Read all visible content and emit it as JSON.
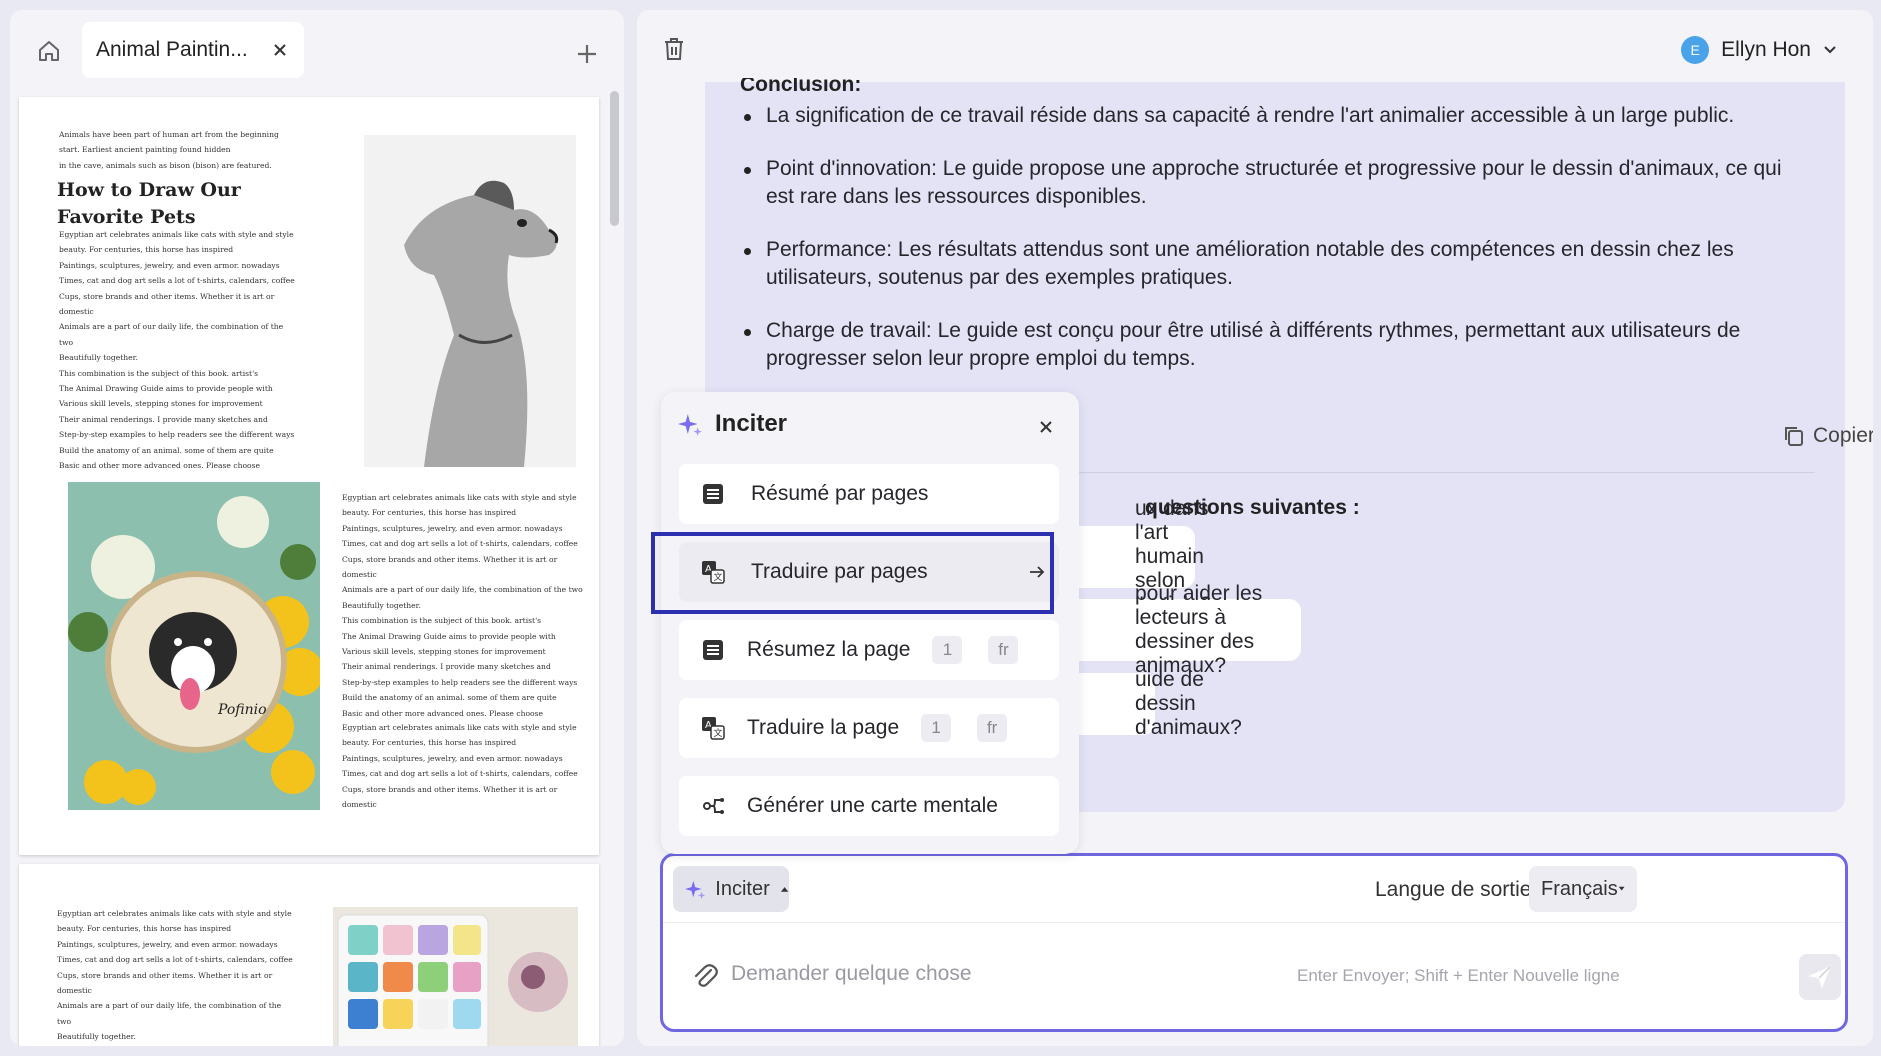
{
  "left": {
    "tab_title": "Animal Paintin...",
    "page1": {
      "intro": "Animals have been part of human art from the beginning\nstart. Earliest ancient painting found hidden\nin the cave, animals such as bison (bison) are featured.",
      "heading": "How to Draw Our\nFavorite Pets",
      "col1": "Egyptian art celebrates animals like cats with style and style\nbeauty. For centuries, this horse has inspired\nPaintings, sculptures, jewelry, and even armor. nowadays\nTimes, cat and dog art sells a lot of t-shirts, calendars, coffee\nCups, store brands and other items. Whether it is art or domestic\nAnimals are a part of our daily life, the combination of the two\nBeautifully together.\nThis combination is the subject of this book. artist's\nThe Animal Drawing Guide aims to provide people with\nVarious skill levels, stepping stones for improvement\nTheir animal renderings. I provide many sketches and\nStep-by-step examples to help readers see the different ways\nBuild the anatomy of an animal. some of them are quite\nBasic and other more advanced ones. Please choose",
      "col2": "Egyptian art celebrates animals like cats with style and style\nbeauty. For centuries, this horse has inspired\nPaintings, sculptures, jewelry, and even armor. nowadays\nTimes, cat and dog art sells a lot of t-shirts, calendars, coffee\nCups, store brands and other items. Whether it is art or domestic\nAnimals are a part of our daily life, the combination of the two\nBeautifully together.\nThis combination is the subject of this book. artist's\nThe Animal Drawing Guide aims to provide people with\nVarious skill levels, stepping stones for improvement\nTheir animal renderings. I provide many sketches and\nStep-by-step examples to help readers see the different ways\nBuild the anatomy of an animal. some of them are quite\nBasic and other more advanced ones. Please choose",
      "col3": "Egyptian art celebrates animals like cats with style and style\nbeauty. For centuries, this horse has inspired\nPaintings, sculptures, jewelry, and even armor. nowadays\nTimes, cat and dog art sells a lot of t-shirts, calendars, coffee\nCups, store brands and other items. Whether it is art or domestic",
      "embroidery_signature": "Pofinio"
    },
    "page2": {
      "col1": "Egyptian art celebrates animals like cats with style and style\nbeauty. For centuries, this horse has inspired\nPaintings, sculptures, jewelry, and even armor. nowadays\nTimes, cat and dog art sells a lot of t-shirts, calendars, coffee\nCups, store brands and other items. Whether it is art or domestic\nAnimals are a part of our daily life, the combination of the two\nBeautifully together.\nThis combination is the subject of this book. artist's\nThe Animal Drawing Guide aims to provide people with\nVarious skill levels, stepping stones for improvement"
    }
  },
  "user": {
    "initial": "E",
    "name": "Ellyn Hon"
  },
  "chat": {
    "conclusion_heading": "Conclusion:",
    "bullets": [
      "La signification de ce travail réside dans sa capacité à rendre l'art animalier accessible à un large public.",
      "Point d'innovation: Le guide propose une approche structurée et progressive pour le dessin d'animaux, ce qui est rare dans les ressources disponibles.",
      "Performance: Les résultats attendus sont une amélioration notable des compétences en dessin chez les utilisateurs, soutenus par des exemples pratiques.",
      "Charge de travail: Le guide est conçu pour être utilisé à différents rythmes, permettant aux utilisateurs de progresser selon leur propre emploi du temps."
    ],
    "copy_label": "Copier",
    "questions_heading": "questions suivantes :",
    "questions": [
      "ux dans l'art humain selon l'article?",
      "pour aider les lecteurs à dessiner des animaux?",
      "uide de dessin d'animaux?"
    ]
  },
  "input": {
    "prompt_label": "Inciter",
    "lang_label": "Langue de sortie",
    "lang_value": "Français",
    "placeholder": "Demander quelque chose",
    "hint": "Enter Envoyer; Shift + Enter Nouvelle ligne"
  },
  "popup": {
    "title": "Inciter",
    "items": [
      {
        "label": "Résumé par pages",
        "icon": "list-icon"
      },
      {
        "label": "Traduire par pages",
        "icon": "translate-icon"
      },
      {
        "label": "Résumez la page",
        "icon": "list-icon",
        "page": "1",
        "lang": "fr"
      },
      {
        "label": "Traduire la page",
        "icon": "translate-icon",
        "page": "1",
        "lang": "fr"
      },
      {
        "label": "Générer une carte mentale",
        "icon": "mindmap-icon"
      }
    ]
  },
  "colors": {
    "accent": "#6f66e0",
    "highlight": "#2b2fb0",
    "chat_bg": "#e4e3f6",
    "avatar": "#4aa3e8"
  }
}
